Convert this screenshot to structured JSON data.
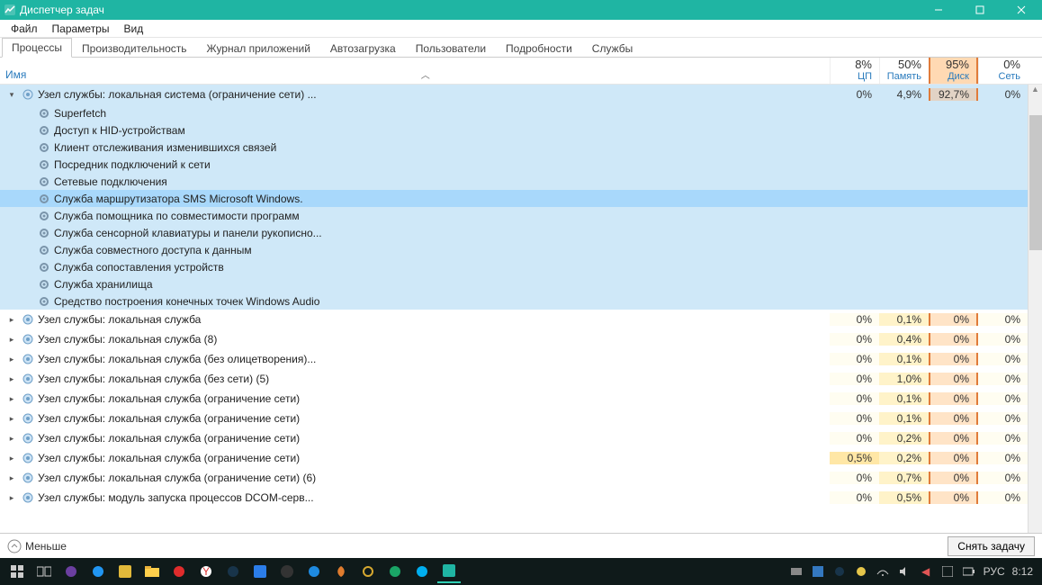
{
  "window": {
    "title": "Диспетчер задач",
    "minimize": "—",
    "maximize": "▢",
    "close": "✕"
  },
  "menu": {
    "file": "Файл",
    "options": "Параметры",
    "view": "Вид"
  },
  "tabs": {
    "processes": "Процессы",
    "performance": "Производительность",
    "app_history": "Журнал приложений",
    "startup": "Автозагрузка",
    "users": "Пользователи",
    "details": "Подробности",
    "services": "Службы"
  },
  "columns": {
    "name_label": "Имя",
    "cpu_pct": "8%",
    "cpu_label": "ЦП",
    "mem_pct": "50%",
    "mem_label": "Память",
    "disk_pct": "95%",
    "disk_label": "Диск",
    "net_pct": "0%",
    "net_label": "Сеть"
  },
  "expanded_group": {
    "name": "Узел службы: локальная система (ограничение сети) ...",
    "cpu": "0%",
    "mem": "4,9%",
    "disk": "92,7%",
    "net": "0%",
    "children": [
      {
        "name": "Superfetch"
      },
      {
        "name": "Доступ к HID-устройствам"
      },
      {
        "name": "Клиент отслеживания изменившихся связей"
      },
      {
        "name": "Посредник подключений к сети"
      },
      {
        "name": "Сетевые подключения"
      },
      {
        "name": "Служба маршрутизатора SMS Microsoft Windows.",
        "selected": true
      },
      {
        "name": "Служба помощника по совместимости программ"
      },
      {
        "name": "Служба сенсорной клавиатуры и панели рукописно..."
      },
      {
        "name": "Служба совместного доступа к данным"
      },
      {
        "name": "Служба сопоставления устройств"
      },
      {
        "name": "Служба хранилища"
      },
      {
        "name": "Средство построения конечных точек Windows Audio"
      }
    ]
  },
  "groups": [
    {
      "name": "Узел службы: локальная служба",
      "cpu": "0%",
      "mem": "0,1%",
      "disk": "0%",
      "net": "0%"
    },
    {
      "name": "Узел службы: локальная служба (8)",
      "cpu": "0%",
      "mem": "0,4%",
      "disk": "0%",
      "net": "0%"
    },
    {
      "name": "Узел службы: локальная служба (без олицетворения)...",
      "cpu": "0%",
      "mem": "0,1%",
      "disk": "0%",
      "net": "0%"
    },
    {
      "name": "Узел службы: локальная служба (без сети) (5)",
      "cpu": "0%",
      "mem": "1,0%",
      "disk": "0%",
      "net": "0%"
    },
    {
      "name": "Узел службы: локальная служба (ограничение сети)",
      "cpu": "0%",
      "mem": "0,1%",
      "disk": "0%",
      "net": "0%"
    },
    {
      "name": "Узел службы: локальная служба (ограничение сети)",
      "cpu": "0%",
      "mem": "0,1%",
      "disk": "0%",
      "net": "0%"
    },
    {
      "name": "Узел службы: локальная служба (ограничение сети)",
      "cpu": "0%",
      "mem": "0,2%",
      "disk": "0%",
      "net": "0%"
    },
    {
      "name": "Узел службы: локальная служба (ограничение сети)",
      "cpu": "0,5%",
      "mem": "0,2%",
      "disk": "0%",
      "net": "0%",
      "hot": true
    },
    {
      "name": "Узел службы: локальная служба (ограничение сети) (6)",
      "cpu": "0%",
      "mem": "0,7%",
      "disk": "0%",
      "net": "0%"
    },
    {
      "name": "Узел службы: модуль запуска процессов DCOM-серв...",
      "cpu": "0%",
      "mem": "0,5%",
      "disk": "0%",
      "net": "0%"
    }
  ],
  "footer": {
    "fewer": "Меньше",
    "end_task": "Снять задачу"
  },
  "taskbar": {
    "lang": "РУС",
    "time": "8:12"
  }
}
